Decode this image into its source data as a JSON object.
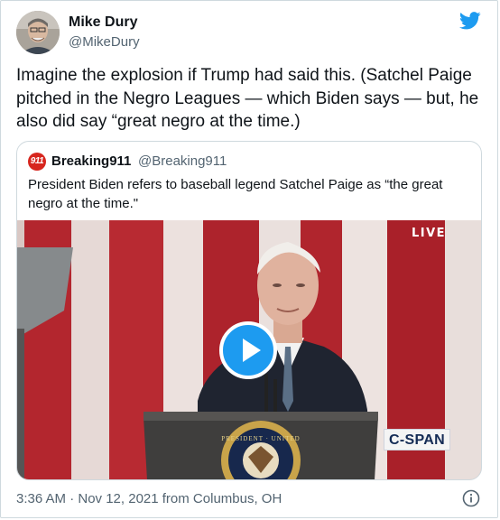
{
  "author": {
    "name": "Mike Dury",
    "handle": "@MikeDury",
    "avatar_icon": "user-photo"
  },
  "tweet": {
    "text": "Imagine the explosion if Trump had said this. (Satchel Paige pitched in the Negro Leagues — which Biden says — but, he also did say “great negro at the time.)",
    "timestamp": "3:36 AM · Nov 12, 2021 from Columbus, OH"
  },
  "quoted_tweet": {
    "avatar_text": "911",
    "name": "Breaking911",
    "handle": "@Breaking911",
    "text": "President Biden refers to baseball legend Satchel Paige as “the great negro at the time.\"",
    "media": {
      "live_label": "LIVE",
      "network_logo": "C-SPAN",
      "seal_text": "PRESIDENT OF THE UNITED"
    }
  },
  "colors": {
    "twitter_blue": "#1d9bf0",
    "text": "#0f1419",
    "secondary_text": "#536471",
    "border": "#cfd9de"
  },
  "icons": {
    "brand": "twitter-bird-icon",
    "play": "play-icon",
    "info": "info-icon"
  }
}
